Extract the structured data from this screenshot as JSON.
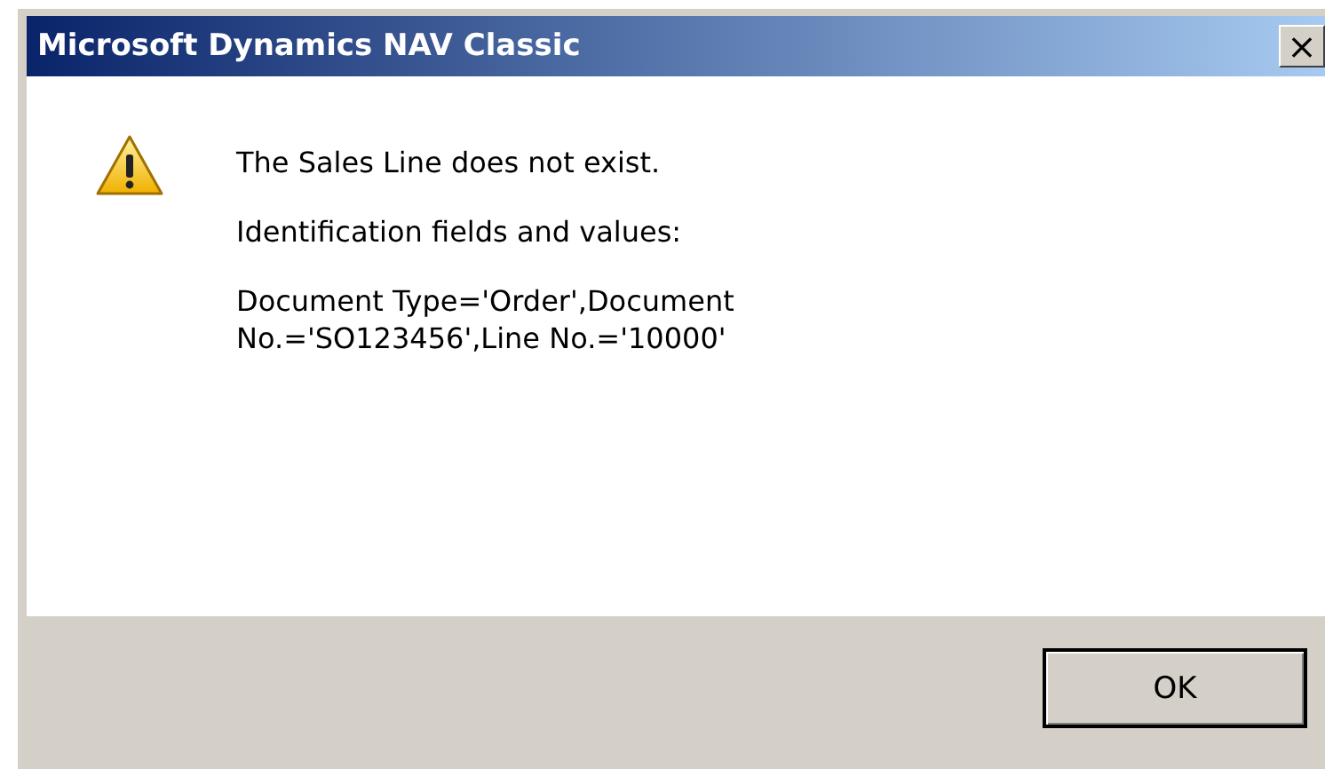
{
  "window": {
    "title": "Microsoft Dynamics NAV Classic",
    "close": "×"
  },
  "messages": [
    "The Sales Line does not exist.",
    "Identification fields and values:",
    "Document Type='Order',Document No.='SO123456',Line No.='10000'"
  ],
  "buttons": [
    "OK"
  ]
}
